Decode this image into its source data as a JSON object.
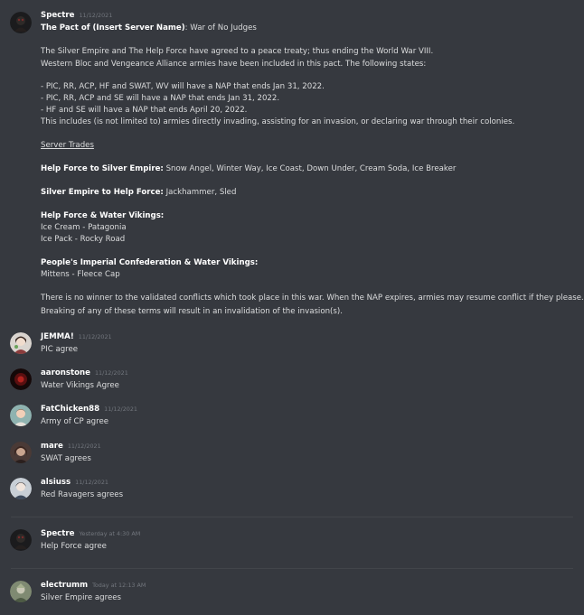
{
  "colors": {
    "background": "#36393f",
    "text": "#dcddde",
    "username": "#ffffff",
    "timestamp": "#72767d",
    "divider": "#42454a"
  },
  "first_message": {
    "author": "Spectre",
    "timestamp": "11/12/2021",
    "avatar": "spectre-avatar",
    "lines": {
      "title_bold": "The Pact of (Insert Server Name)",
      "title_rest": ": War of No Judges",
      "p1_l1": "The Silver Empire and The Help Force have agreed to a peace treaty; thus ending the World War VIII.",
      "p1_l2": "Western Bloc and Vengeance Alliance armies have been included in this pact. The following states:",
      "b1": "- PIC, RR, ACP, HF and SWAT, WV will have a NAP that ends Jan 31, 2022.",
      "b2": "- PIC, RR, ACP and SE will have a NAP that ends Jan 31, 2022.",
      "b3": "- HF and SE will have a NAP that ends April 20, 2022.",
      "b4": "This includes (is not limited to) armies directly invading, assisting for an invasion, or declaring war through their colonies.",
      "server_trades": "Server Trades",
      "hf_se_bold": "Help Force to Silver Empire:",
      "hf_se_rest": " Snow Angel, Winter Way, Ice Coast, Down Under, Cream Soda, Ice Breaker",
      "se_hf_bold": "Silver Empire to Help Force:",
      "se_hf_rest": " Jackhammer, Sled",
      "hf_wv_bold": "Help Force & Water Vikings:",
      "hf_wv_1": "Ice Cream - Patagonia",
      "hf_wv_2": "Ice Pack - Rocky Road",
      "pic_wv_bold": "People's Imperial Confederation & Water Vikings:",
      "pic_wv_1": "Mittens - Fleece Cap",
      "end_1": "There is no winner to the validated conflicts which took place in this war. When the NAP expires, armies may resume conflict if they please.",
      "end_2": "Breaking of any of these terms will result in an invalidation of the invasion(s)."
    }
  },
  "replies": [
    {
      "author": "JEMMA!",
      "timestamp": "11/12/2021",
      "text": "PIC agree",
      "avatar": "jemma-avatar"
    },
    {
      "author": "aaronstone",
      "timestamp": "11/12/2021",
      "text": "Water Vikings Agree",
      "avatar": "aaronstone-avatar"
    },
    {
      "author": "FatChicken88",
      "timestamp": "11/12/2021",
      "text": "Army of CP agree",
      "avatar": "fatchicken-avatar"
    },
    {
      "author": "mare",
      "timestamp": "11/12/2021",
      "text": "SWAT agrees",
      "avatar": "mare-avatar"
    },
    {
      "author": "alsiuss",
      "timestamp": "11/12/2021",
      "text": "Red Ravagers agrees",
      "avatar": "alsiuss-avatar"
    },
    {
      "author": "Spectre",
      "timestamp": "Yesterday at 4:30 AM",
      "text": "Help Force agree",
      "avatar": "spectre-avatar"
    },
    {
      "author": "electrumm",
      "timestamp": "Today at 12:13 AM",
      "text": "Silver Empire agrees",
      "avatar": "electrumm-avatar"
    }
  ]
}
